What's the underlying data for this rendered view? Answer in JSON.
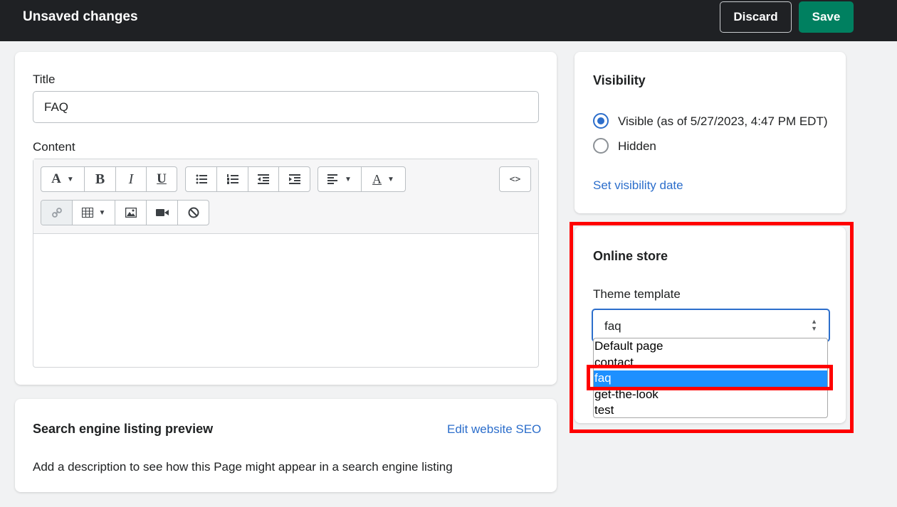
{
  "topbar": {
    "title": "Unsaved changes",
    "discard_label": "Discard",
    "save_label": "Save"
  },
  "page_editor": {
    "title_label": "Title",
    "title_value": "FAQ",
    "content_label": "Content",
    "toolbar": {
      "font_glyph": "A",
      "bold_glyph": "B",
      "italic_glyph": "I",
      "underline_glyph": "U",
      "code_glyph": "<>",
      "align_glyph": "≡",
      "text_color_glyph": "A"
    }
  },
  "seo": {
    "heading": "Search engine listing preview",
    "edit_link": "Edit website SEO",
    "description": "Add a description to see how this Page might appear in a search engine listing"
  },
  "visibility": {
    "heading": "Visibility",
    "options": [
      {
        "label": "Visible (as of 5/27/2023, 4:47 PM EDT)",
        "checked": true
      },
      {
        "label": "Hidden",
        "checked": false
      }
    ],
    "set_date_link": "Set visibility date"
  },
  "online_store": {
    "heading": "Online store",
    "template_label": "Theme template",
    "selected_value": "faq",
    "options": [
      "Default page",
      "contact",
      "faq",
      "get-the-look",
      "test"
    ],
    "highlighted_index": 2
  },
  "colors": {
    "topbar_bg": "#1f2124",
    "save_green": "#008060",
    "link_blue": "#2c6ecb",
    "highlight_blue": "#1e90ff",
    "annotation_red": "#ff0000"
  }
}
